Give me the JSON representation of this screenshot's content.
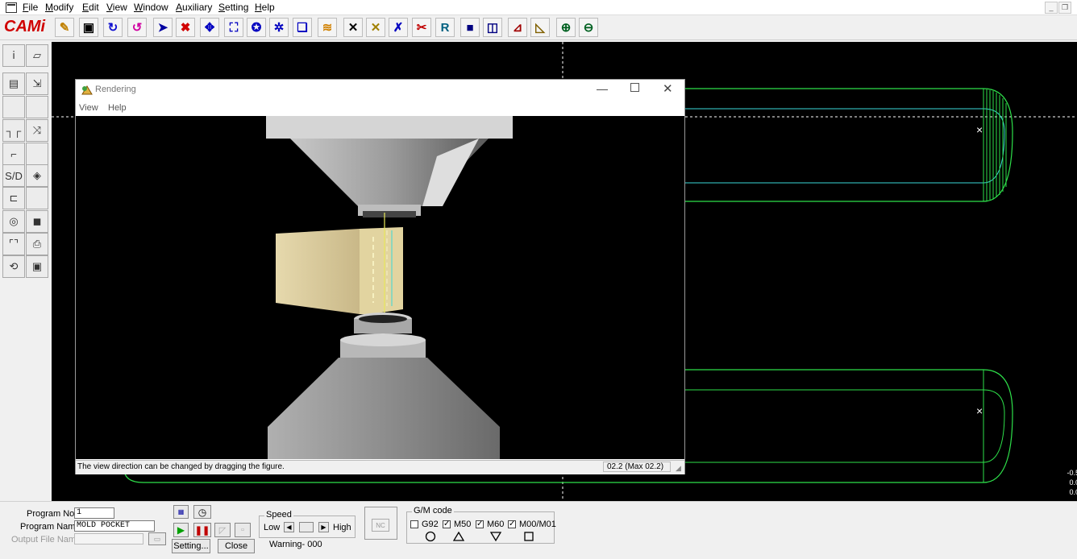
{
  "menu": {
    "items": [
      {
        "label": "File",
        "u": "F",
        "rest": "ile"
      },
      {
        "label": "Modify",
        "u": "M",
        "rest": "odify"
      },
      {
        "label": "Edit",
        "u": "E",
        "rest": "dit"
      },
      {
        "label": "View",
        "u": "V",
        "rest": "iew"
      },
      {
        "label": "Window",
        "u": "W",
        "rest": "indow"
      },
      {
        "label": "Auxiliary",
        "u": "A",
        "rest": "uxiliary"
      },
      {
        "label": "Setting",
        "u": "S",
        "rest": "etting"
      },
      {
        "label": "Help",
        "u": "H",
        "rest": "elp"
      }
    ]
  },
  "toolbar": {
    "logo": "CAMi",
    "r_button_label": "R"
  },
  "palette": {
    "sd_label": "S/D"
  },
  "workspace": {
    "marker": "×",
    "readout": [
      "-0.5",
      "0.0",
      "0.0"
    ]
  },
  "rendering": {
    "title": "Rendering",
    "menu": [
      "View",
      "Help"
    ],
    "status_text": "The view direction can be changed by dragging the figure.",
    "status_value": "02.2 (Max 02.2)"
  },
  "bottom": {
    "program_no_label": "Program No.",
    "program_no_value": "1",
    "program_name_label": "Program Name",
    "program_name_value": "MOLD POCKET",
    "output_file_label": "Output File Name",
    "output_file_value": "",
    "setting_button": "Setting...",
    "close_button": "Close",
    "speed_caption": "Speed",
    "speed_low": "Low",
    "speed_high": "High",
    "warning_text": "Warning- 000",
    "nc_label": "NC",
    "gm_caption": "G/M code",
    "gm_codes": [
      {
        "label": "G92",
        "checked": false
      },
      {
        "label": "M50",
        "checked": true
      },
      {
        "label": "M60",
        "checked": true
      },
      {
        "label": "M00/M01",
        "checked": true
      }
    ]
  },
  "colors": {
    "workspace_bg": "#000000",
    "path_green": "#2ee04a",
    "path_cyan": "#3ad8d8",
    "workpiece": "#e8dcb0",
    "logo_red": "#d00000"
  }
}
